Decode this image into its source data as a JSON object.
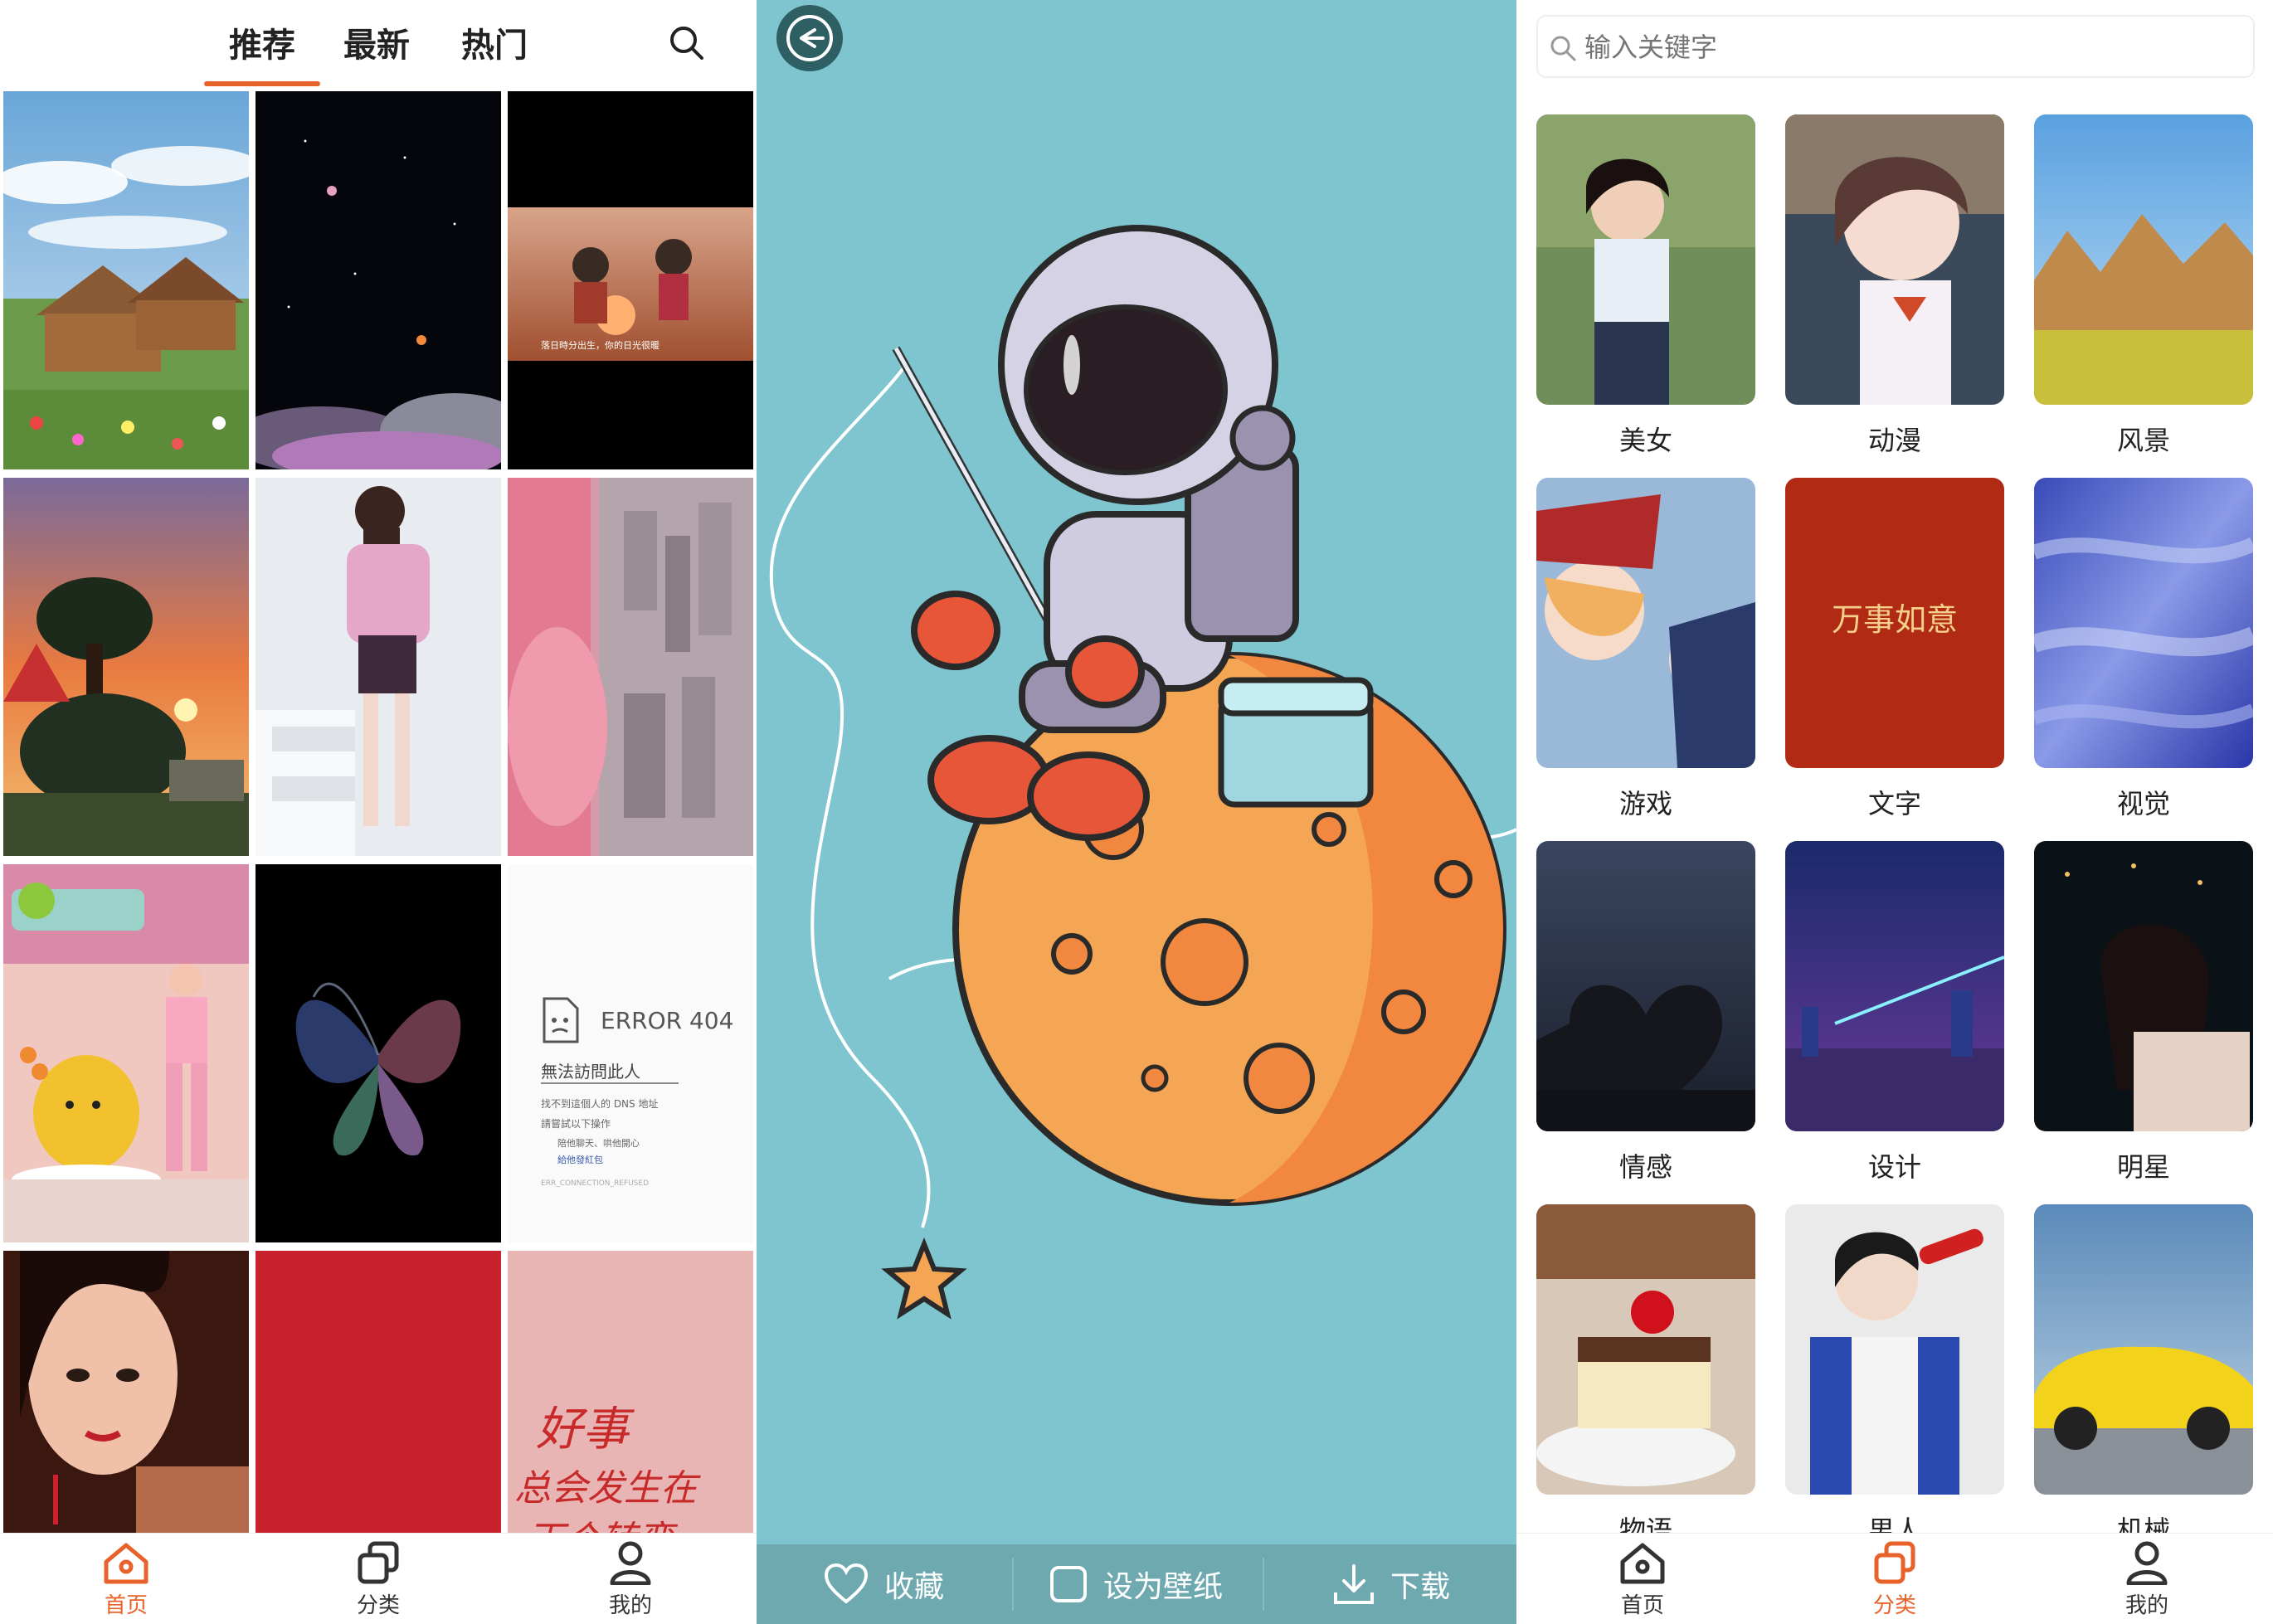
{
  "screen1": {
    "tabs": [
      {
        "label": "推荐",
        "active": true
      },
      {
        "label": "最新",
        "active": false
      },
      {
        "label": "热门",
        "active": false
      }
    ],
    "error_card": {
      "title": "ERROR 404",
      "subtitle": "無法訪問此人",
      "line1": "找不到這個人的 DNS 地址",
      "line2": "請嘗試以下操作",
      "bullet1": "陪他聊天、哄他開心",
      "bullet2": "給他發紅包",
      "code": "ERR_CONNECTION_REFUSED"
    },
    "calligraphy": {
      "line1": "好事",
      "line2": "总会发生在",
      "line3": "下个转弯"
    },
    "sunset_caption": "落日時分出生，你的日光很暖",
    "nav": [
      {
        "label": "首页",
        "active": true
      },
      {
        "label": "分类",
        "active": false
      },
      {
        "label": "我的",
        "active": false
      }
    ]
  },
  "screen2": {
    "actions": [
      {
        "label": "收藏",
        "icon": "heart-icon"
      },
      {
        "label": "设为壁纸",
        "icon": "square-icon"
      },
      {
        "label": "下载",
        "icon": "download-icon"
      }
    ]
  },
  "screen3": {
    "search_placeholder": "输入关键字",
    "categories": [
      {
        "label": "美女"
      },
      {
        "label": "动漫"
      },
      {
        "label": "风景"
      },
      {
        "label": "游戏"
      },
      {
        "label": "文字"
      },
      {
        "label": "视觉"
      },
      {
        "label": "情感"
      },
      {
        "label": "设计"
      },
      {
        "label": "明星"
      },
      {
        "label": "物语"
      },
      {
        "label": "男人"
      },
      {
        "label": "机械"
      }
    ],
    "text_card": "万事如意",
    "nav": [
      {
        "label": "首页",
        "active": false
      },
      {
        "label": "分类",
        "active": true
      },
      {
        "label": "我的",
        "active": false
      }
    ]
  },
  "colors": {
    "accent": "#e8622c",
    "teal": "#7ec5cf",
    "action_bar": "#6fa9b0"
  }
}
